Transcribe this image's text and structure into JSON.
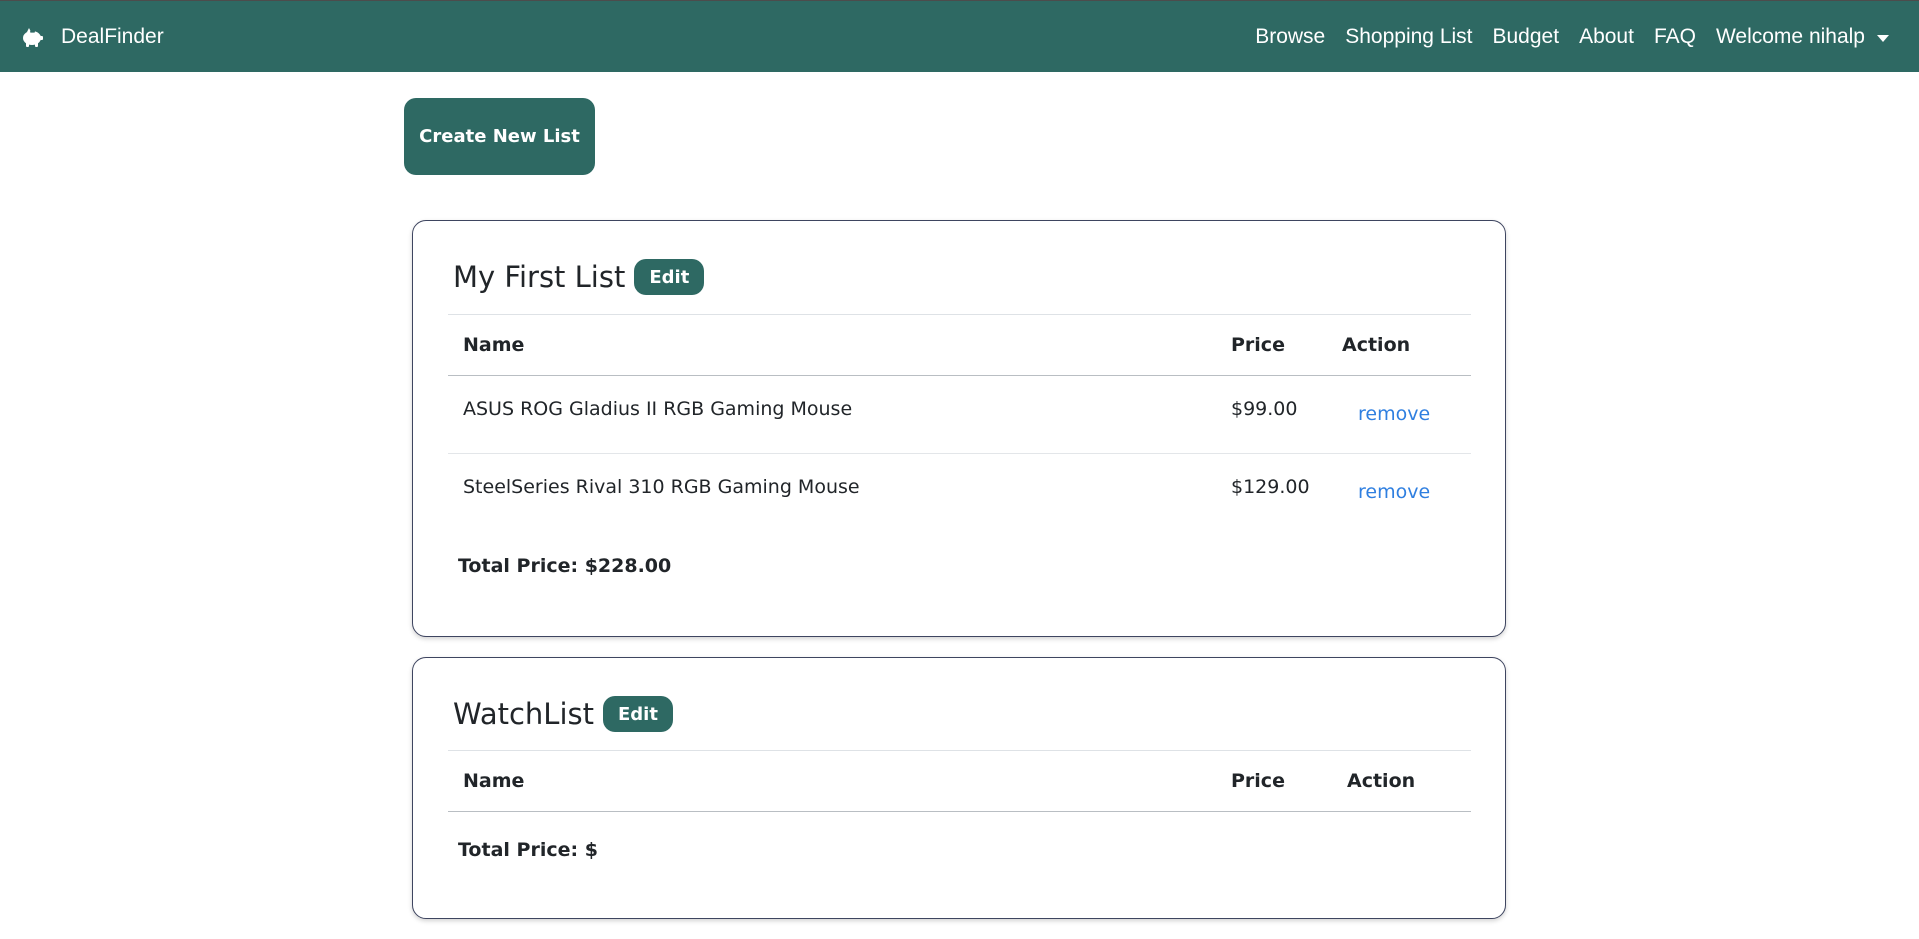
{
  "navbar": {
    "brand": "DealFinder",
    "brand_icon": "piggy-bank-icon",
    "links": [
      "Browse",
      "Shopping List",
      "Budget",
      "About",
      "FAQ"
    ],
    "user_menu": "Welcome nihalp"
  },
  "actions": {
    "create_label": "Create New List"
  },
  "lists": [
    {
      "title": "My First List",
      "edit_label": "Edit",
      "columns": [
        "Name",
        "Price",
        "Action"
      ],
      "items": [
        {
          "name": "ASUS ROG Gladius II RGB Gaming Mouse",
          "price": "$99.00",
          "action": "remove"
        },
        {
          "name": "SteelSeries Rival 310 RGB Gaming Mouse",
          "price": "$129.00",
          "action": "remove"
        }
      ],
      "total": "Total Price: $228.00"
    },
    {
      "title": "WatchList",
      "edit_label": "Edit",
      "columns": [
        "Name",
        "Price",
        "Action"
      ],
      "items": [],
      "total": "Total Price: $"
    }
  ],
  "colors": {
    "primary": "#2e6963",
    "link": "#2f7fe0"
  }
}
